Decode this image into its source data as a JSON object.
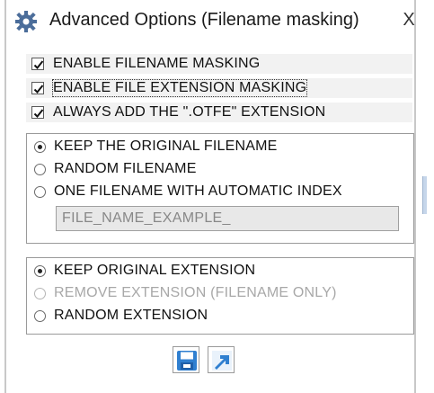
{
  "window": {
    "title": "Advanced Options (Filename masking)",
    "close_label": "X",
    "app_icon": "gear-icon"
  },
  "options": {
    "enable_filename_masking": {
      "label": "ENABLE FILENAME MASKING",
      "checked": true
    },
    "enable_extension_masking": {
      "label": "ENABLE FILE EXTENSION MASKING",
      "checked": true
    },
    "always_add_extension": {
      "label": "ALWAYS ADD THE \".OTFE\" EXTENSION",
      "checked": true
    }
  },
  "filename_group": {
    "keep_original": {
      "label": "KEEP THE ORIGINAL FILENAME",
      "selected": true
    },
    "random": {
      "label": "RANDOM FILENAME",
      "selected": false
    },
    "auto_index": {
      "label": "ONE FILENAME WITH AUTOMATIC INDEX",
      "selected": false
    },
    "example_value": "FILE_NAME_EXAMPLE_"
  },
  "extension_group": {
    "keep_original": {
      "label": "KEEP ORIGINAL EXTENSION",
      "selected": true
    },
    "remove": {
      "label": "REMOVE EXTENSION (FILENAME ONLY)",
      "selected": false,
      "disabled": true
    },
    "random": {
      "label": "RANDOM EXTENSION",
      "selected": false
    }
  },
  "footer": {
    "save_icon": "save-icon",
    "apply_icon": "arrow-icon"
  },
  "colors": {
    "accent_blue": "#2f7fd0",
    "disabled_text": "#a8a8a8",
    "row_background": "#f2f2f2"
  }
}
